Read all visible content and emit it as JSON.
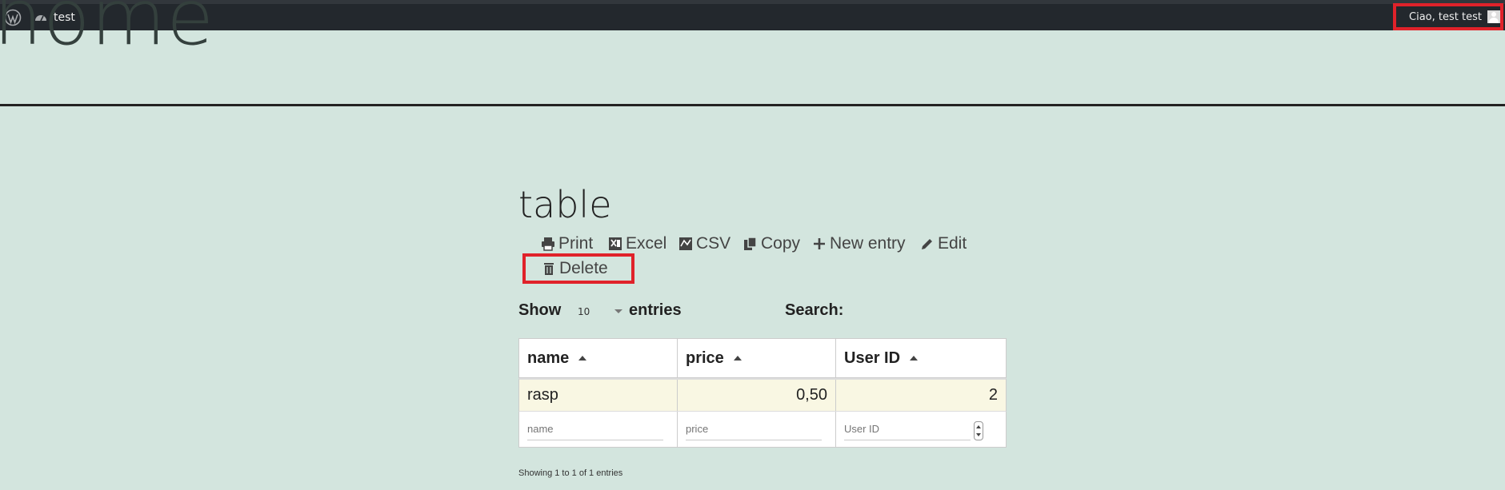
{
  "admin_bar": {
    "site_name": "test",
    "user_greeting": "Ciao, test test",
    "icons": [
      "wordpress-logo-icon",
      "dashboard-icon",
      "avatar"
    ]
  },
  "site": {
    "title": "home"
  },
  "page": {
    "heading": "table"
  },
  "toolbar": {
    "print": "Print",
    "excel": "Excel",
    "csv": "CSV",
    "copy": "Copy",
    "new_entry": "New entry",
    "edit": "Edit",
    "delete": "Delete"
  },
  "table_controls": {
    "show_label": "Show",
    "page_length": "10",
    "entries_label": "entries",
    "search_label": "Search:"
  },
  "table": {
    "columns": [
      "name",
      "price",
      "User ID"
    ],
    "rows": [
      [
        "rasp",
        "0,50",
        "2"
      ]
    ],
    "filter_placeholders": [
      "name",
      "price",
      "User ID"
    ]
  },
  "info": "Showing 1 to 1 of 1 entries",
  "colors": {
    "background": "#d3e5de",
    "admin_bar": "#23282d",
    "highlight": "#e0222a",
    "row_selected": "#f9f7e3"
  }
}
